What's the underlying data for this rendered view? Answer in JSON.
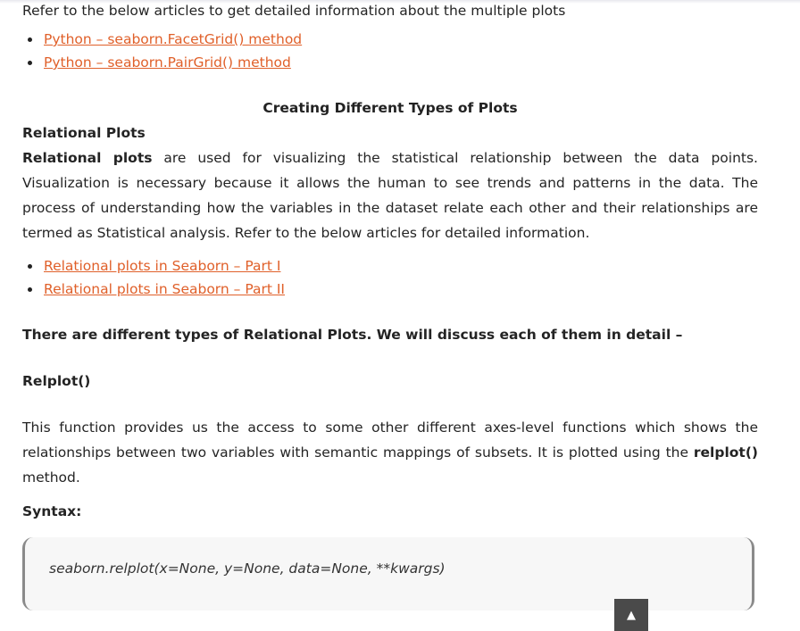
{
  "intro": {
    "text": "Refer to the below articles to get detailed information about the multiple plots"
  },
  "links_multiple": [
    "Python – seaborn.FacetGrid() method",
    "Python – seaborn.PairGrid() method"
  ],
  "section": {
    "heading": "Creating Different Types of Plots",
    "relational_heading": "Relational Plots",
    "relational_bold": "Relational plots",
    "relational_text": " are used for visualizing the statistical relationship between the data points. Visualization is necessary because it allows the human to see trends and patterns in the data. The process of understanding how the variables in the dataset relate each other and their relationships are termed as Statistical analysis. Refer to the below articles for detailed information."
  },
  "links_relational": [
    "Relational plots in Seaborn – Part I",
    "Relational plots in Seaborn – Part II"
  ],
  "types_note": "There are different types of Relational Plots. We will discuss each of them in detail –",
  "relplot": {
    "heading": "Relplot()",
    "desc_start": "This function provides us the access to some other different axes-level functions which shows the relationships between two variables with semantic mappings of subsets. It is plotted using the ",
    "desc_bold": "relplot()",
    "desc_end": " method.",
    "syntax_label": "Syntax:",
    "code": "seaborn.relplot(x=None, y=None, data=None, **kwargs)"
  },
  "scroll_top": {
    "icon": "▲"
  },
  "colors": {
    "link": "#e0602a",
    "scroll_button": "#4a4a4a"
  }
}
